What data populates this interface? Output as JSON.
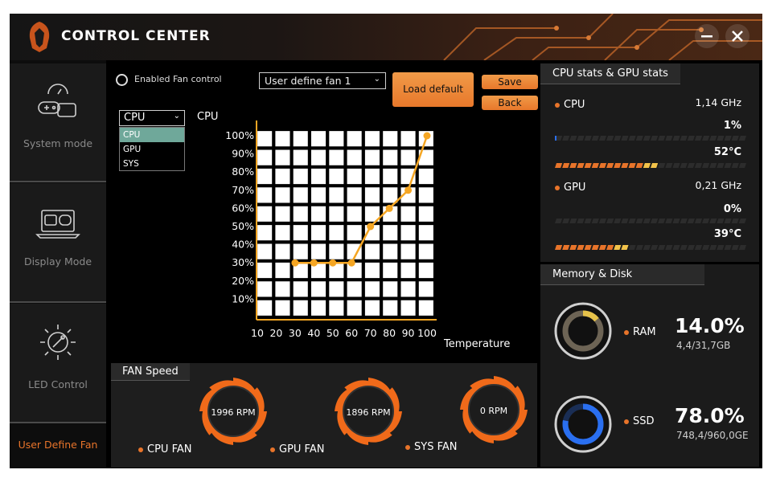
{
  "app": {
    "title": "CONTROL CENTER"
  },
  "window": {
    "minimize_icon": "minus-icon",
    "close_icon": "close-icon"
  },
  "sidebar": {
    "items": [
      {
        "label": "System mode",
        "icon": "gamepad-speedometer-icon",
        "active": false
      },
      {
        "label": "Display Mode",
        "icon": "laptop-gamepad-icon",
        "active": false
      },
      {
        "label": "LED Control",
        "icon": "led-sun-icon",
        "active": false
      },
      {
        "label": "User Define Fan",
        "icon": "",
        "active": true
      }
    ]
  },
  "fan_control": {
    "enable_label": "Enabled Fan control",
    "profile_select": "User define fan 1",
    "load_default": "Load default",
    "save": "Save",
    "back": "Back",
    "source_select": "CPU",
    "source_options": [
      "CPU",
      "GPU",
      "SYS"
    ],
    "selected_source": "CPU"
  },
  "chart_data": {
    "type": "line",
    "ylabel": "CPU",
    "xlabel": "Temperature",
    "x_ticks": [
      10,
      20,
      30,
      40,
      50,
      60,
      70,
      80,
      90,
      100
    ],
    "y_ticks": [
      "100%",
      "90%",
      "80%",
      "70%",
      "60%",
      "50%",
      "40%",
      "30%",
      "20%",
      "10%"
    ],
    "xlim": [
      10,
      100
    ],
    "ylim": [
      0,
      100
    ],
    "grid": true,
    "series": [
      {
        "x": [
          30,
          40,
          50,
          60,
          70,
          80,
          90,
          100
        ],
        "y": [
          30,
          30,
          30,
          30,
          50,
          60,
          70,
          100
        ]
      }
    ],
    "accent": "#f5a623"
  },
  "fan_speed": {
    "title": "FAN Speed",
    "fans": [
      {
        "label": "CPU FAN",
        "rpm": "1996 RPM"
      },
      {
        "label": "GPU FAN",
        "rpm": "1896 RPM"
      },
      {
        "label": "SYS FAN",
        "rpm": "0 RPM"
      }
    ]
  },
  "stats": {
    "title": "CPU stats & GPU stats",
    "cpu": {
      "label": "CPU",
      "freq": "1,14 GHz",
      "usage": "1%",
      "temp": "52°C",
      "usage_fraction": 0.01,
      "temp_fraction": 0.52
    },
    "gpu": {
      "label": "GPU",
      "freq": "0,21 GHz",
      "usage": "0%",
      "temp": "39°C",
      "usage_fraction": 0.0,
      "temp_fraction": 0.39
    }
  },
  "memory": {
    "title": "Memory & Disk",
    "ram": {
      "label": "RAM",
      "percent": "14.0%",
      "detail": "4,4/31,7GB",
      "fraction": 0.14
    },
    "ssd": {
      "label": "SSD",
      "percent": "78.0%",
      "detail": "748,4/960,0GE",
      "fraction": 0.78
    }
  },
  "colors": {
    "accent": "#e8742a",
    "line": "#f5a623",
    "ssd_ring": "#2a6ff0",
    "background": "#000000"
  }
}
